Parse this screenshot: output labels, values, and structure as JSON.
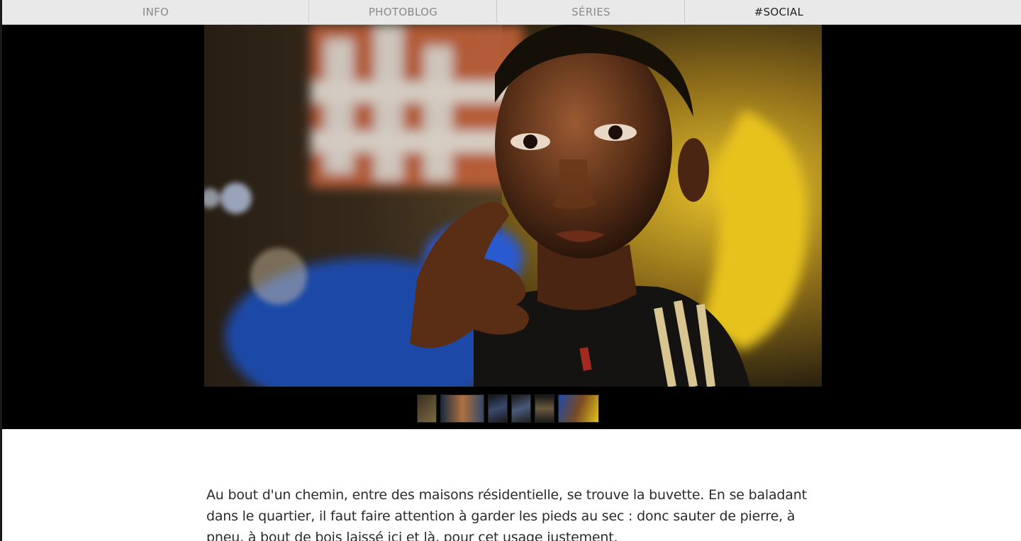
{
  "nav": {
    "items": [
      {
        "label": "INFO"
      },
      {
        "label": "PHOTOBLOG"
      },
      {
        "label": "SÉRIES"
      },
      {
        "label": "#SOCIAL"
      }
    ]
  },
  "hero": {
    "thumbnails_count": 6
  },
  "article": {
    "paragraph": "Au bout d'un chemin, entre des maisons résidentielle, se trouve la buvette. En se baladant dans le quartier, il faut faire attention à garder les pieds au sec : donc sauter de pierre, à pneu, à bout de bois laissé ici et là, pour cet usage justement."
  }
}
